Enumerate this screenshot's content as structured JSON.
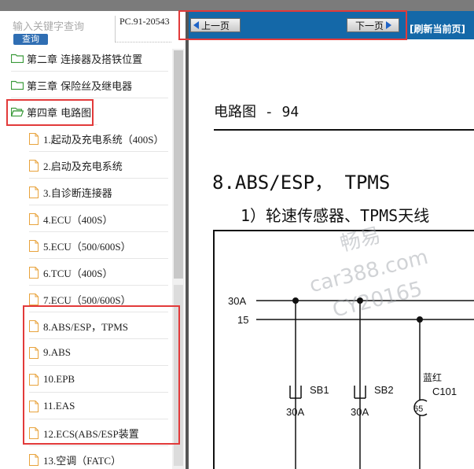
{
  "search": {
    "placeholder": "输入关键字查询",
    "button_label": "查询",
    "pc_code": "PC.91-20543"
  },
  "tree": {
    "chapters": [
      {
        "label": "第二章 连接器及搭铁位置"
      },
      {
        "label": "第三章 保险丝及继电器"
      },
      {
        "label": "第四章 电路图"
      }
    ],
    "items": [
      {
        "label": "1.起动及充电系统（400S）"
      },
      {
        "label": "2.启动及充电系统"
      },
      {
        "label": "3.自诊断连接器"
      },
      {
        "label": "4.ECU（400S）"
      },
      {
        "label": "5.ECU（500/600S）"
      },
      {
        "label": "6.TCU（400S）"
      },
      {
        "label": "7.ECU（500/600S）"
      },
      {
        "label": "8.ABS/ESP，TPMS"
      },
      {
        "label": "9.ABS"
      },
      {
        "label": "10.EPB"
      },
      {
        "label": "11.EAS"
      },
      {
        "label": "12.ECS(ABS/ESP装置"
      },
      {
        "label": "13.空调（FATC）"
      }
    ]
  },
  "toolbar": {
    "prev_label": "上一页",
    "next_label": "下一页",
    "refresh_label": "[刷新当前页]"
  },
  "document": {
    "page_heading": "电路图 - 94",
    "section_title": "8.ABS/ESP， TPMS",
    "subsection_title": "1）轮速传感器、TPMS天线",
    "diagram": {
      "rail_30a": "30A",
      "rail_15": "15",
      "wire_color": "蓝红",
      "fuse_sb1": {
        "name": "SB1",
        "rating": "30A"
      },
      "fuse_sb2": {
        "name": "SB2",
        "rating": "30A"
      },
      "connector": {
        "name": "C101",
        "pin": "65"
      }
    },
    "watermark": {
      "line1": "畅易",
      "line2": "car388.com",
      "line3": "CY20165"
    }
  },
  "colors": {
    "toolbar": "#1468a8",
    "highlight": "#e23a3a",
    "search_button": "#2f6eb3",
    "folder_icon": "#3a9a3a",
    "file_icon": "#e8a33c"
  }
}
